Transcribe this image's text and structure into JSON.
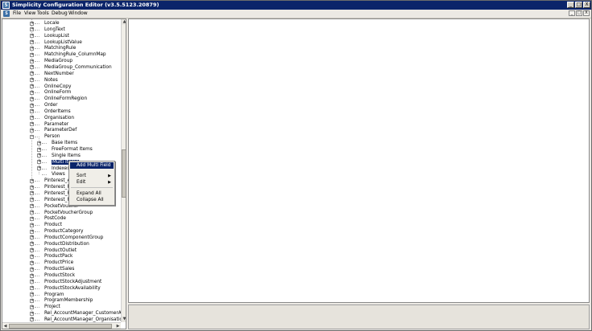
{
  "window": {
    "title": "Simplicity Configuration Editor (v3.5.5123.20879)",
    "controls": [
      "_",
      "□",
      "X"
    ]
  },
  "menubar": {
    "app_icon": "S",
    "items": [
      "File",
      "View",
      "Tools",
      "Debug",
      "Window"
    ],
    "mdi_controls": [
      "_",
      "□",
      "X"
    ]
  },
  "tree": {
    "items": [
      {
        "label": "Locale",
        "level": 0,
        "expander": "+"
      },
      {
        "label": "LongText",
        "level": 0,
        "expander": "+"
      },
      {
        "label": "LookupList",
        "level": 0,
        "expander": "+"
      },
      {
        "label": "LookupListValue",
        "level": 0,
        "expander": "+"
      },
      {
        "label": "MatchingRule",
        "level": 0,
        "expander": "+"
      },
      {
        "label": "MatchingRule_ColumnMap",
        "level": 0,
        "expander": "+"
      },
      {
        "label": "MediaGroup",
        "level": 0,
        "expander": "+"
      },
      {
        "label": "MediaGroup_Communication",
        "level": 0,
        "expander": "+"
      },
      {
        "label": "NextNumber",
        "level": 0,
        "expander": "+"
      },
      {
        "label": "Notes",
        "level": 0,
        "expander": "+"
      },
      {
        "label": "OnlineCopy",
        "level": 0,
        "expander": "+"
      },
      {
        "label": "OnlineForm",
        "level": 0,
        "expander": "+"
      },
      {
        "label": "OnlineFormRegion",
        "level": 0,
        "expander": "+"
      },
      {
        "label": "Order",
        "level": 0,
        "expander": "+"
      },
      {
        "label": "OrderItems",
        "level": 0,
        "expander": "+"
      },
      {
        "label": "Organisation",
        "level": 0,
        "expander": "+"
      },
      {
        "label": "Parameter",
        "level": 0,
        "expander": "+"
      },
      {
        "label": "ParameterDef",
        "level": 0,
        "expander": "+"
      },
      {
        "label": "Person",
        "level": 0,
        "expander": "−"
      },
      {
        "label": "Base Items",
        "level": 1,
        "expander": "+"
      },
      {
        "label": "FreeFormat Items",
        "level": 1,
        "expander": "+"
      },
      {
        "label": "Single Items",
        "level": 1,
        "expander": "+"
      },
      {
        "label": "Multi Items",
        "level": 1,
        "expander": "+",
        "selected": true
      },
      {
        "label": "Indexes",
        "level": 1,
        "expander": "+"
      },
      {
        "label": "Views",
        "level": 1,
        "expander": ""
      },
      {
        "label": "Pinterest_Ap",
        "level": 0,
        "expander": "+"
      },
      {
        "label": "Pinterest_Pa",
        "level": 0,
        "expander": "+"
      },
      {
        "label": "Pinterest_Po",
        "level": 0,
        "expander": "+"
      },
      {
        "label": "Pinterest_Po",
        "level": 0,
        "expander": "+"
      },
      {
        "label": "PocketVoucher",
        "level": 0,
        "expander": "+"
      },
      {
        "label": "PocketVoucherGroup",
        "level": 0,
        "expander": "+"
      },
      {
        "label": "PostCode",
        "level": 0,
        "expander": "+"
      },
      {
        "label": "Product",
        "level": 0,
        "expander": "+"
      },
      {
        "label": "ProductCategory",
        "level": 0,
        "expander": "+"
      },
      {
        "label": "ProductComponentGroup",
        "level": 0,
        "expander": "+"
      },
      {
        "label": "ProductDistribution",
        "level": 0,
        "expander": "+"
      },
      {
        "label": "ProductOutlet",
        "level": 0,
        "expander": "+"
      },
      {
        "label": "ProductPack",
        "level": 0,
        "expander": "+"
      },
      {
        "label": "ProductPrice",
        "level": 0,
        "expander": "+"
      },
      {
        "label": "ProductSales",
        "level": 0,
        "expander": "+"
      },
      {
        "label": "ProductStock",
        "level": 0,
        "expander": "+"
      },
      {
        "label": "ProductStockAdjustment",
        "level": 0,
        "expander": "+"
      },
      {
        "label": "ProductStockAvailability",
        "level": 0,
        "expander": "+"
      },
      {
        "label": "Program",
        "level": 0,
        "expander": "+"
      },
      {
        "label": "ProgramMembership",
        "level": 0,
        "expander": "+"
      },
      {
        "label": "Project",
        "level": 0,
        "expander": "+"
      },
      {
        "label": "Rel_AccountManager_CustomerAccoun",
        "level": 0,
        "expander": "+"
      },
      {
        "label": "Rel_AccountManager_Organisation",
        "level": 0,
        "expander": "+"
      }
    ]
  },
  "context_menu": {
    "items": [
      {
        "label": "Add Multi Field",
        "selected": true,
        "submenu": false
      },
      {
        "label": "Sort",
        "selected": false,
        "submenu": true
      },
      {
        "label": "Edit",
        "selected": false,
        "submenu": true
      },
      {
        "label": "Expand All",
        "selected": false,
        "submenu": false
      },
      {
        "label": "Collapse All",
        "selected": false,
        "submenu": false
      }
    ],
    "submenu_arrow": "▶"
  },
  "colors": {
    "titlebar": "#0b246a",
    "selection": "#0a246a",
    "chrome": "#ece9e4"
  }
}
